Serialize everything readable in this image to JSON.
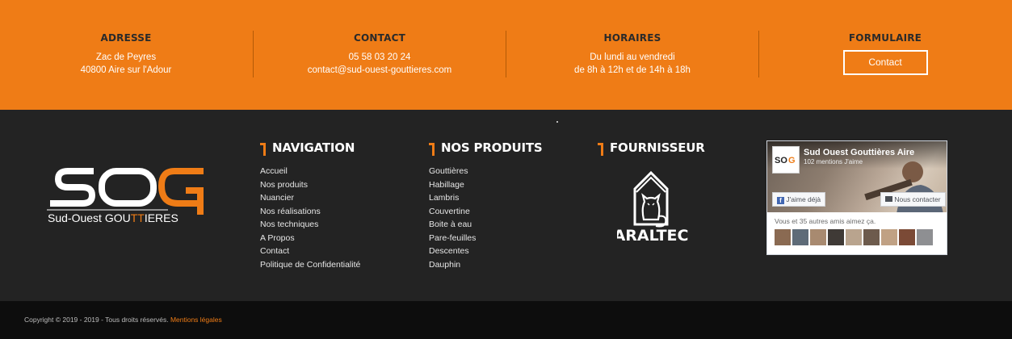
{
  "info_band": {
    "address": {
      "title": "ADRESSE",
      "line1": "Zac de Peyres",
      "line2": "40800 Aire sur l'Adour"
    },
    "contact": {
      "title": "CONTACT",
      "phone": "05 58 03 20 24",
      "email": "contact@sud-ouest-gouttieres.com"
    },
    "hours": {
      "title": "HORAIRES",
      "line1": "Du lundi au vendredi",
      "line2": "de 8h à 12h et de 14h à 18h"
    },
    "form": {
      "title": "FORMULAIRE",
      "button_label": "Contact"
    }
  },
  "logo": {
    "letters_main": "SO",
    "letter_accent": "G",
    "tagline_a": "Sud-Ouest GOU",
    "tagline_accent": "TT",
    "tagline_b": "IERES"
  },
  "navigation": {
    "title": "NAVIGATION",
    "items": [
      "Accueil",
      "Nos produits",
      "Nuancier",
      "Nos réalisations",
      "Nos techniques",
      "A Propos",
      "Contact",
      "Politique de Confidentialité"
    ]
  },
  "products": {
    "title": "NOS PRODUITS",
    "items": [
      "Gouttières",
      "Habillage",
      "Lambris",
      "Couvertine",
      "Boite à eau",
      "Pare-feuilles",
      "Descentes",
      "Dauphin"
    ]
  },
  "supplier": {
    "title": "FOURNISSEUR",
    "brand": "ARALTEC"
  },
  "facebook": {
    "page_name": "Sud Ouest Gouttières Aire",
    "likes": "102 mentions J'aime",
    "like_button": "J'aime déjà",
    "contact_button": "Nous contacter",
    "friends_text": "Vous et 35 autres amis aimez ça.",
    "friend_faces": 9
  },
  "copyright": {
    "text": "Copyright © 2019 - 2019 - Tous droits réservés.",
    "link": "Mentions légales"
  },
  "colors": {
    "accent": "#ef7c16",
    "footer_bg": "#232323",
    "bottom_bg": "#0d0d0d"
  }
}
